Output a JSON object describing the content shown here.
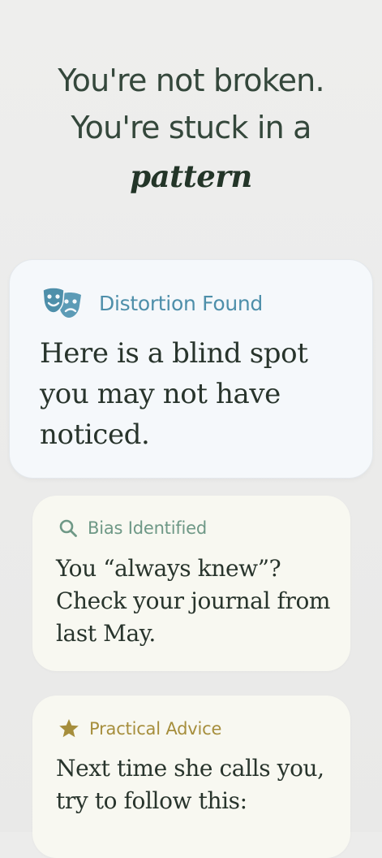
{
  "hero": {
    "line1": "You're not broken.",
    "line2": "You're stuck in a",
    "emphasis": "pattern"
  },
  "cards": [
    {
      "icon": "theater-masks-icon",
      "tag": "Distortion Found",
      "text": "Here is a blind spot you may not have noticed.",
      "accent": "#4e8faa"
    },
    {
      "icon": "search-icon",
      "tag": "Bias Identified",
      "text": "You “always knew”? Check your journal from last May.",
      "accent": "#6e9886"
    },
    {
      "icon": "star-icon",
      "tag": "Practical Advice",
      "text": "Next time she calls you, try to follow this:",
      "accent": "#a68e3c"
    }
  ]
}
